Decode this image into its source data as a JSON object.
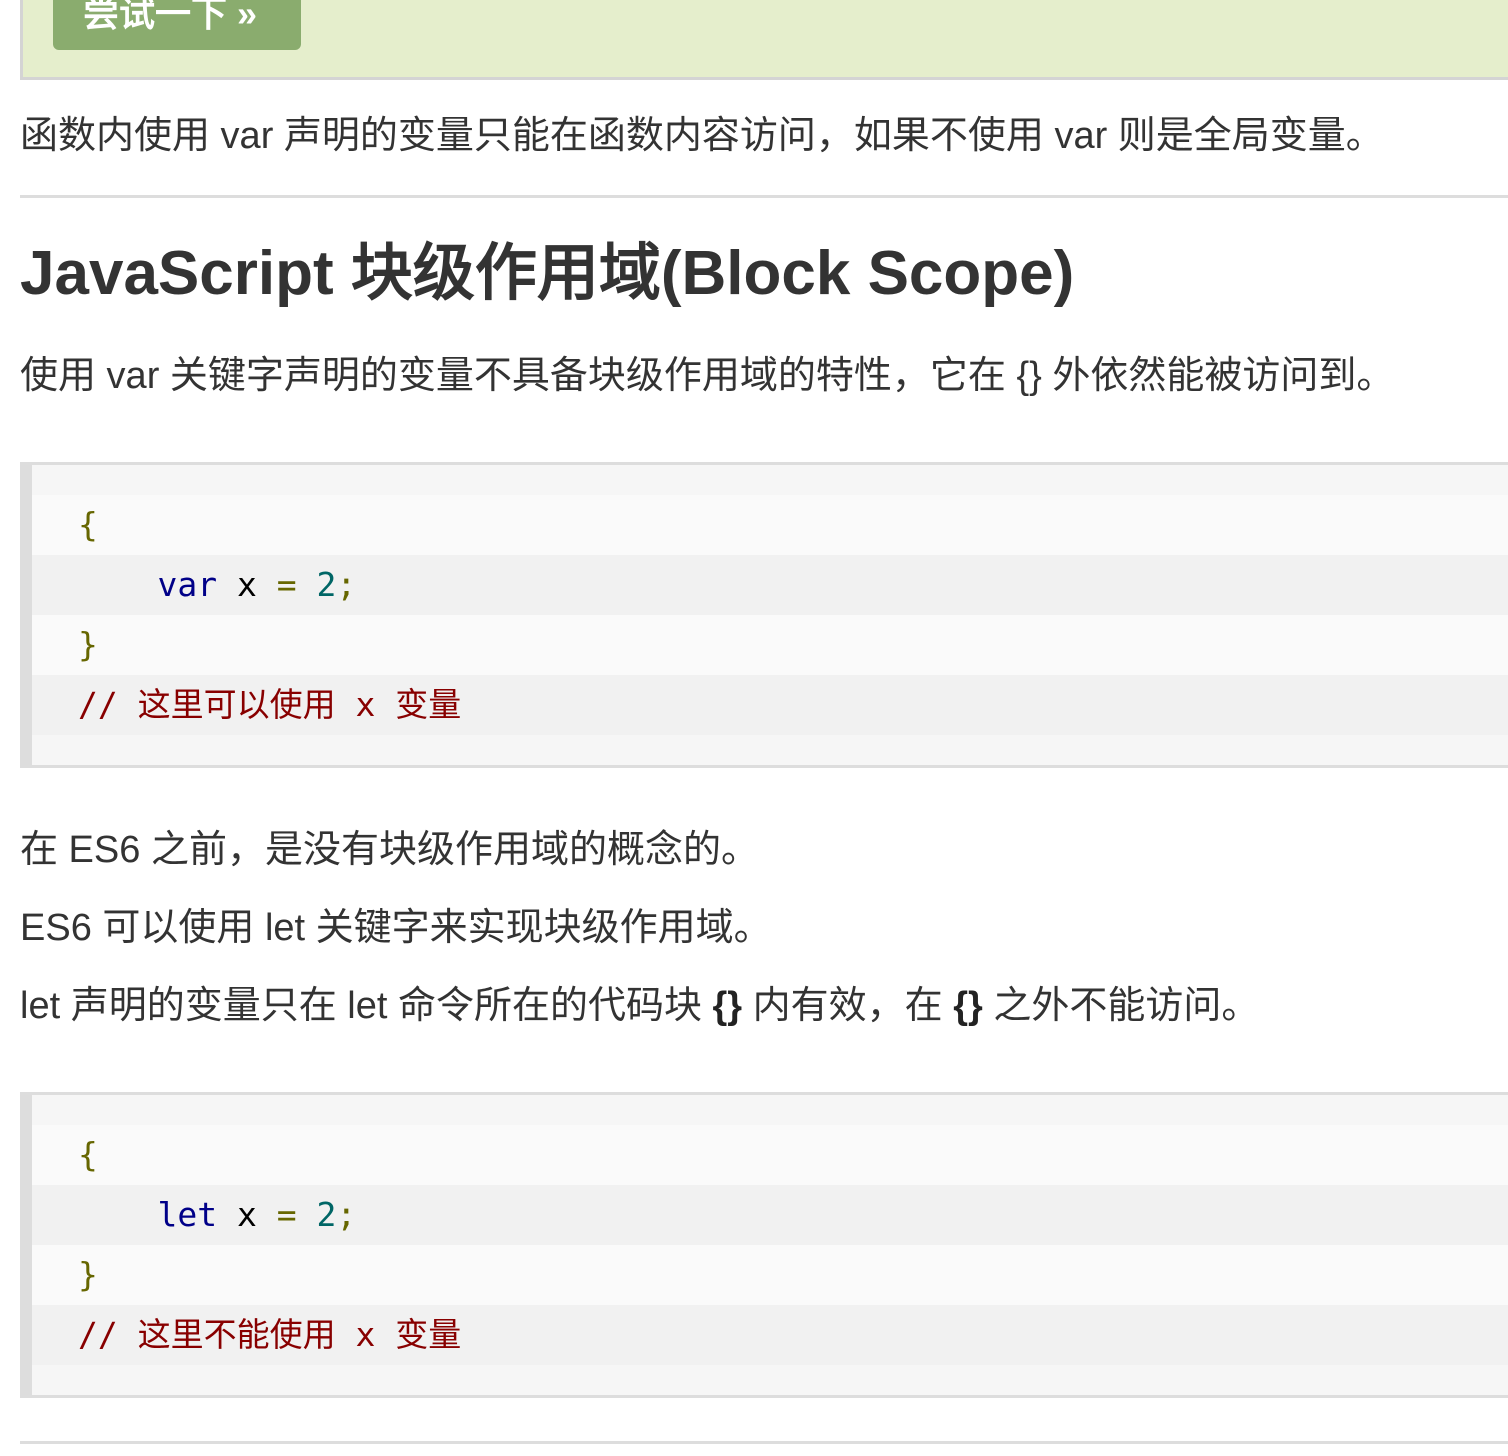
{
  "try_button": {
    "label": "尝试一下 »"
  },
  "intro": {
    "text": "函数内使用 var 声明的变量只能在函数内容访问，如果不使用 var 则是全局变量。"
  },
  "section": {
    "title": "JavaScript 块级作用域(Block Scope)",
    "desc": "使用 var 关键字声明的变量不具备块级作用域的特性，它在 {} 外依然能被访问到。",
    "es6_before": "在 ES6 之前，是没有块级作用域的概念的。",
    "es6_let": "ES6 可以使用 let 关键字来实现块级作用域。",
    "let_desc": {
      "prefix": "let 声明的变量只在 let 命令所在的代码块 ",
      "braces1": "{}",
      "middle": " 内有效，在 ",
      "braces2": "{}",
      "suffix": " 之外不能访问。"
    }
  },
  "code_var": {
    "open_brace": "{",
    "indent": "    ",
    "keyword": "var",
    "ident": " x ",
    "op": "=",
    "value": " 2",
    "semi": ";",
    "close_brace": "}",
    "comment": "// 这里可以使用 x 变量"
  },
  "code_let": {
    "open_brace": "{",
    "indent": "    ",
    "keyword": "let",
    "ident": " x ",
    "op": "=",
    "value": " 2",
    "semi": ";",
    "close_brace": "}",
    "comment": "// 这里不能使用 x 变量"
  }
}
